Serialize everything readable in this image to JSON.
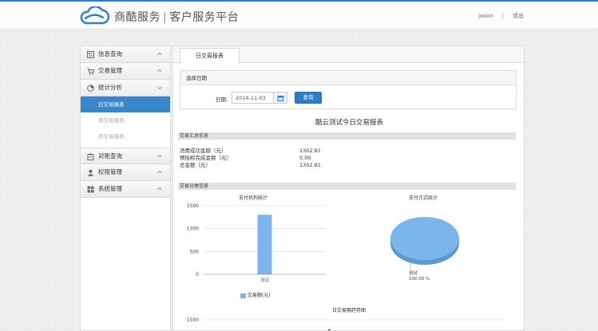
{
  "header": {
    "brand_name": "商酷服务",
    "brand_sep": "|",
    "platform_name": "客户服务平台",
    "user": "jason",
    "divider": "|",
    "logout": "退出"
  },
  "sidebar": {
    "items": [
      {
        "label": "信息查询",
        "icon": "info-icon"
      },
      {
        "label": "交易管理",
        "icon": "cart-icon"
      },
      {
        "label": "统计分析",
        "icon": "pie-icon"
      }
    ],
    "sub_items": [
      {
        "label": "日交易报表",
        "active": true
      },
      {
        "label": "周交易报表",
        "active": false
      },
      {
        "label": "月交易报表",
        "active": false
      }
    ],
    "items_after": [
      {
        "label": "对账查询",
        "icon": "clipboard-icon"
      },
      {
        "label": "权限管理",
        "icon": "user-icon"
      },
      {
        "label": "系统管理",
        "icon": "grid-icon"
      }
    ]
  },
  "tabs": [
    {
      "label": "日交易报表"
    }
  ],
  "date_panel": {
    "heading": "选择日期",
    "label": "日期:",
    "value": "2014-11-03",
    "query_button": "查询"
  },
  "report": {
    "title": "酷云测试今日交易报表",
    "summary_section": "交易汇总信息",
    "summary": [
      {
        "label": "消费成功金额（元）",
        "value": "1302.81"
      },
      {
        "label": "预授权完成金额（元）",
        "value": "0.00"
      },
      {
        "label": "总金额（元）",
        "value": "1302.81"
      }
    ],
    "category_section": "交易分类信息"
  },
  "chart_data": [
    {
      "type": "bar",
      "title": "支付机构统计",
      "categories": [
        "测试"
      ],
      "series": [
        {
          "name": "交易额(元)",
          "values": [
            1302.81
          ]
        }
      ],
      "ylim": [
        0,
        1500
      ],
      "yticks": [
        0,
        500,
        1000,
        1500
      ],
      "color": "#7cb5ec",
      "legend": "bottom"
    },
    {
      "type": "pie",
      "title": "支付方式统计",
      "slices": [
        {
          "label": "测试",
          "value": 100.0,
          "percent_label": "100.00 %"
        }
      ],
      "color": "#7cb5ec"
    },
    {
      "type": "line",
      "title": "日交易额趋势图",
      "yticks": [
        1500
      ]
    }
  ]
}
